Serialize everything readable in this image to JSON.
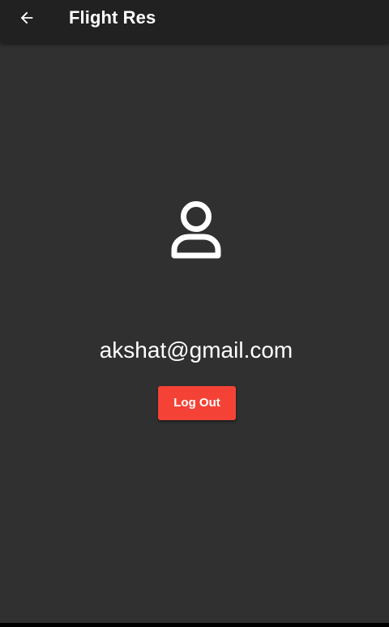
{
  "app_bar": {
    "title": "Flight Res",
    "back_icon": "arrow-left-icon",
    "background": "#212121"
  },
  "profile": {
    "icon": "user-icon",
    "email": "akshat@gmail.com"
  },
  "actions": {
    "logout_label": "Log Out",
    "logout_color": "#f44336"
  },
  "theme": {
    "background": "#303030",
    "text": "#ffffff"
  }
}
